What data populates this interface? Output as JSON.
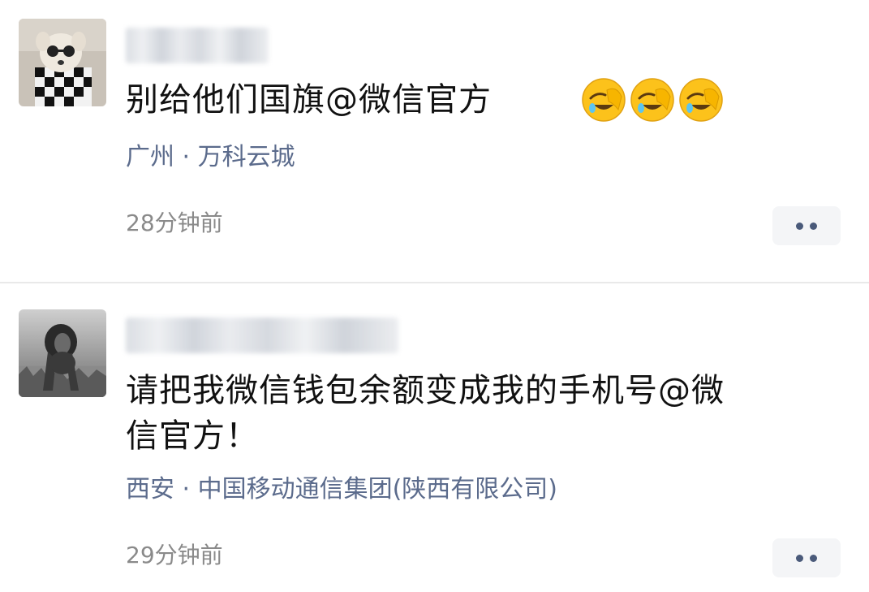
{
  "comments": [
    {
      "avatar": "dog-in-checkered-sweater-avatar",
      "text": "别给他们国旗@微信官方",
      "emojis": [
        "facepalm-laughing-emoji",
        "facepalm-laughing-emoji",
        "facepalm-laughing-emoji"
      ],
      "location": "广州 · 万科云城",
      "time": "28分钟前",
      "more_icon": "more-dots-icon"
    },
    {
      "avatar": "lion-grayscale-avatar",
      "text_line1": "请把我微信钱包余额变成我的手机号@微",
      "text_line2": "信官方！",
      "location": "西安 · 中国移动通信集团(陕西有限公司)",
      "time": "29分钟前",
      "more_icon": "more-dots-icon"
    }
  ],
  "colors": {
    "location_text": "#5b6b8c",
    "time_text": "#8a8a8a",
    "divider": "#e9e9e9",
    "more_button_bg": "#f4f5f7",
    "more_dots": "#4a5a7a"
  }
}
